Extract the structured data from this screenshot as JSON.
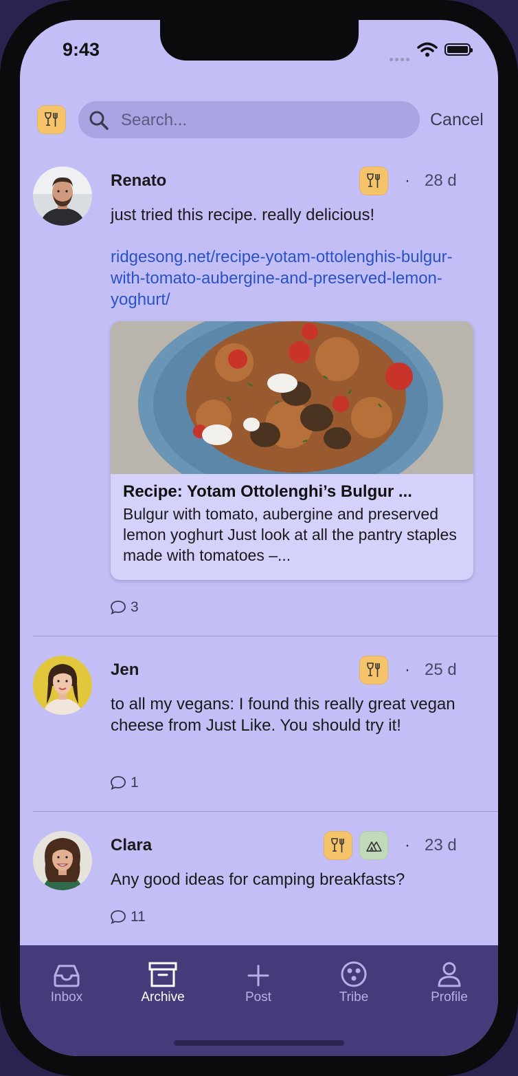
{
  "status_bar": {
    "time": "9:43"
  },
  "search": {
    "placeholder": "Search...",
    "cancel_label": "Cancel",
    "filter_icon": "dining-icon"
  },
  "posts": [
    {
      "author": "Renato",
      "age": "28 d",
      "tags": [
        "dining-icon"
      ],
      "text": "just tried this recipe. really delicious!",
      "link": "ridgesong.net/recipe-yotam-ottolenghis-bulgur-with-tomato-aubergine-and-preserved-lemon-yoghurt/",
      "preview": {
        "title": "Recipe: Yotam Ottolenghi’s Bulgur ...",
        "description": "Bulgur with tomato, aubergine and preserved lemon yoghurt   Just look at all the pantry staples made with tomatoes –..."
      },
      "comment_count": "3"
    },
    {
      "author": "Jen",
      "age": "25 d",
      "tags": [
        "dining-icon"
      ],
      "text": "to all my vegans: I found this really great vegan cheese from Just Like. You should try it!",
      "comment_count": "1"
    },
    {
      "author": "Clara",
      "age": "23 d",
      "tags": [
        "dining-icon",
        "camping-icon"
      ],
      "text": "Any good ideas for camping breakfasts?",
      "comment_count": "11"
    }
  ],
  "separator": "·",
  "tabbar": {
    "items": [
      {
        "label": "Inbox",
        "icon": "inbox-icon",
        "active": false
      },
      {
        "label": "Archive",
        "icon": "archive-icon",
        "active": true
      },
      {
        "label": "Post",
        "icon": "plus-icon",
        "active": false
      },
      {
        "label": "Tribe",
        "icon": "tribe-icon",
        "active": false
      },
      {
        "label": "Profile",
        "icon": "profile-icon",
        "active": false
      }
    ]
  },
  "colors": {
    "background": "#c3bff6",
    "tabbar": "#463b7a",
    "tag_food": "#f5c36a",
    "tag_outdoor": "#c1d9b8",
    "link": "#2a52c7"
  }
}
